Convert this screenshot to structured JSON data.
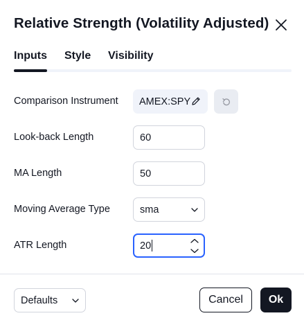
{
  "dialog": {
    "title": "Relative Strength (Volatility Adjusted)",
    "close_icon": "close-icon"
  },
  "tabs": [
    {
      "label": "Inputs",
      "active": true
    },
    {
      "label": "Style",
      "active": false
    },
    {
      "label": "Visibility",
      "active": false
    }
  ],
  "inputs": {
    "comparison_instrument": {
      "label": "Comparison Instrument",
      "value": "AMEX:SPY",
      "edit_icon": "pencil-icon",
      "reset_icon": "reset-icon"
    },
    "lookback_length": {
      "label": "Look-back Length",
      "value": "60"
    },
    "ma_length": {
      "label": "MA Length",
      "value": "50"
    },
    "ma_type": {
      "label": "Moving Average Type",
      "value": "sma",
      "icon": "chevron-down-icon"
    },
    "atr_length": {
      "label": "ATR Length",
      "value": "20",
      "focused": true
    }
  },
  "footer": {
    "defaults_label": "Defaults",
    "cancel_label": "Cancel",
    "ok_label": "Ok"
  },
  "colors": {
    "text": "#131722",
    "focus": "#2962ff",
    "border": "#d1d4dc",
    "muted_bg": "#f0f3fa"
  }
}
